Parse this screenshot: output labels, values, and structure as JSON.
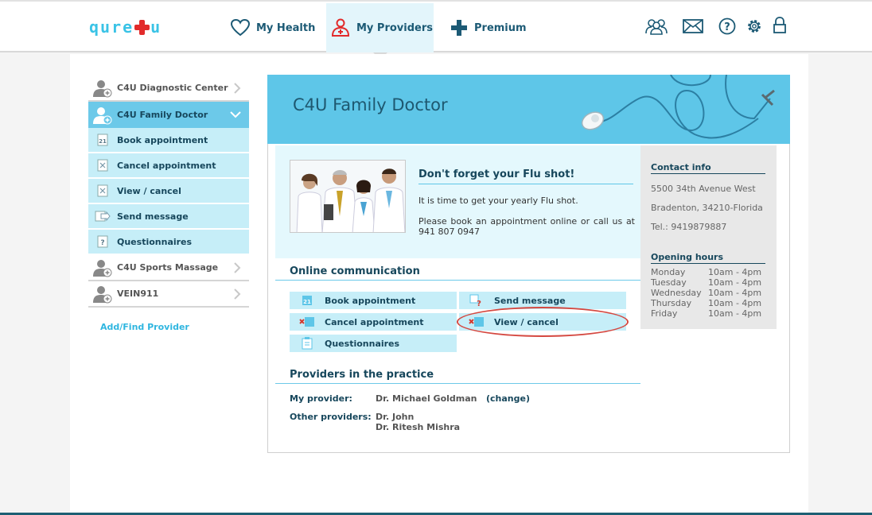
{
  "brand": {
    "logo_left": "qure",
    "logo_right": "u"
  },
  "topnav": {
    "tabs": [
      {
        "label": "My Health",
        "icon": "heart-icon"
      },
      {
        "label": "My Providers",
        "icon": "doctor-icon"
      },
      {
        "label": "Premium",
        "icon": "plus-icon"
      }
    ],
    "right_icons": [
      "users-icon",
      "mail-icon",
      "help-icon",
      "settings-icon",
      "lock-icon"
    ]
  },
  "sidebar": {
    "items": [
      {
        "label": "C4U Diagnostic Center",
        "type": "provider",
        "active": false
      },
      {
        "label": "C4U Family Doctor",
        "type": "provider",
        "active": true
      },
      {
        "label": "Book appointment",
        "type": "sub"
      },
      {
        "label": "Cancel appointment",
        "type": "sub"
      },
      {
        "label": "View / cancel",
        "type": "sub"
      },
      {
        "label": "Send message",
        "type": "sub"
      },
      {
        "label": "Questionnaires",
        "type": "sub"
      },
      {
        "label": "C4U Sports Massage",
        "type": "provider",
        "active": false
      },
      {
        "label": "VEIN911",
        "type": "provider",
        "active": false
      }
    ],
    "add_link": "Add/Find Provider"
  },
  "main": {
    "banner_title": "C4U Family Doctor",
    "flu": {
      "title": "Don't forget your Flu shot!",
      "line1": "It is time to get your yearly Flu shot.",
      "line2": "Please book an appointment online or call us at 941 807 0947"
    },
    "online_comm": {
      "title": "Online communication",
      "buttons": {
        "book": "Book appointment",
        "send": "Send message",
        "cancel": "Cancel appointment",
        "view": "View / cancel",
        "quest": "Questionnaires"
      }
    },
    "providers": {
      "title": "Providers in the practice",
      "my_label": "My provider:",
      "my_value": "Dr. Michael Goldman",
      "change": "(change)",
      "other_label": "Other providers:",
      "other_values": [
        "Dr. John",
        "Dr. Ritesh Mishra"
      ]
    }
  },
  "contact": {
    "title": "Contact info",
    "address1": "5500 34th Avenue West",
    "address2": "Bradenton, 34210-Florida",
    "phone": "Tel.: 9419879887",
    "hours_title": "Opening hours",
    "hours": [
      {
        "day": "Monday",
        "time": "10am - 4pm"
      },
      {
        "day": "Tuesday",
        "time": "10am - 4pm"
      },
      {
        "day": "Wednesday",
        "time": "10am - 4pm"
      },
      {
        "day": "Thursday",
        "time": "10am - 4pm"
      },
      {
        "day": "Friday",
        "time": "10am - 4pm"
      }
    ]
  },
  "colors": {
    "accent": "#5ec6e8",
    "light": "#c6eef8",
    "dark": "#17475c",
    "logo_plus": "#e22b2b",
    "highlight": "#d54840"
  }
}
